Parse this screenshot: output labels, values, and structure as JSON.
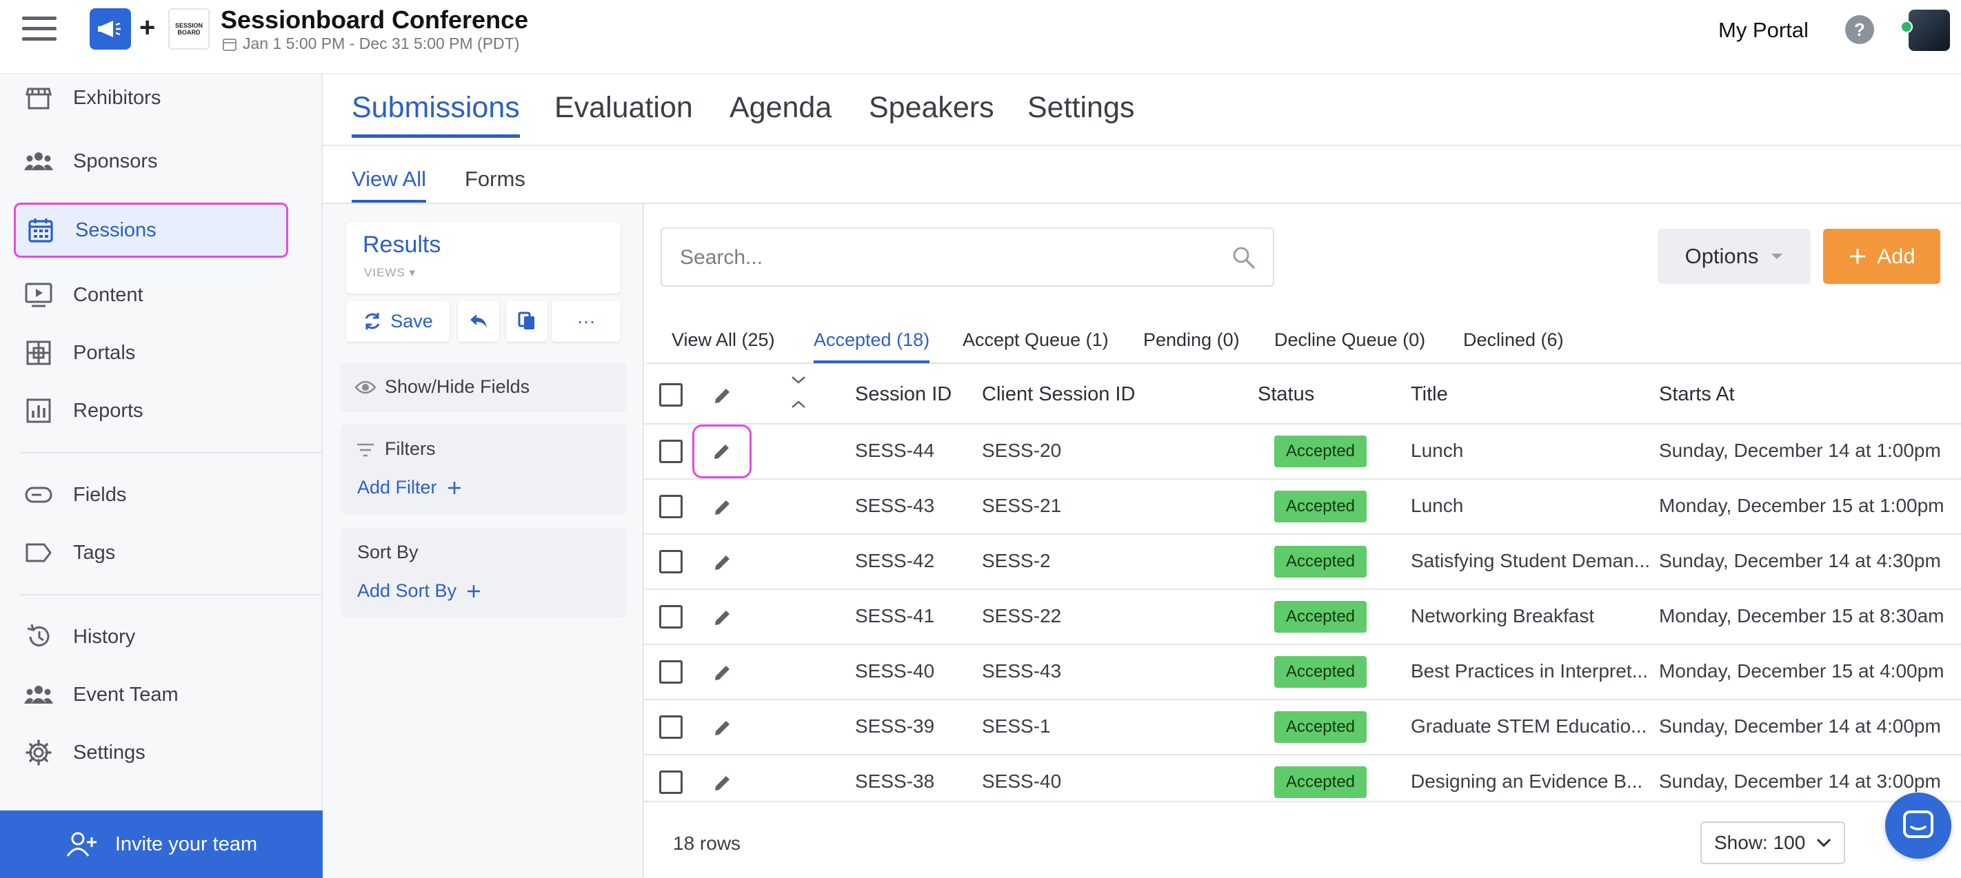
{
  "header": {
    "title": "Sessionboard Conference",
    "date_range": "Jan 1 5:00 PM - Dec 31 5:00 PM (PDT)",
    "logo_text": "SESSION BOARD",
    "my_portal": "My Portal",
    "help": "?"
  },
  "sidebar": {
    "items": [
      {
        "label": "Exhibitors",
        "icon": "store-icon"
      },
      {
        "label": "Sponsors",
        "icon": "group-icon"
      },
      {
        "label": "Sessions",
        "icon": "calendar-icon"
      },
      {
        "label": "Content",
        "icon": "video-icon"
      },
      {
        "label": "Portals",
        "icon": "portal-icon"
      },
      {
        "label": "Reports",
        "icon": "chart-icon"
      },
      {
        "label": "Fields",
        "icon": "field-icon"
      },
      {
        "label": "Tags",
        "icon": "tag-icon"
      },
      {
        "label": "History",
        "icon": "history-icon"
      },
      {
        "label": "Event Team",
        "icon": "team-icon"
      },
      {
        "label": "Settings",
        "icon": "gear-icon"
      }
    ],
    "active_item": "Sessions",
    "invite_label": "Invite your team"
  },
  "main_tabs": [
    "Submissions",
    "Evaluation",
    "Agenda",
    "Speakers",
    "Settings"
  ],
  "sub_tabs": [
    "View All",
    "Forms"
  ],
  "panel": {
    "results_title": "Results",
    "views_label": "VIEWS",
    "save_label": "Save",
    "more_label": "···",
    "show_hide_label": "Show/Hide Fields",
    "filters_label": "Filters",
    "add_filter_label": "Add Filter",
    "sort_by_label": "Sort By",
    "add_sort_label": "Add Sort By"
  },
  "toolbar": {
    "search_placeholder": "Search...",
    "options_label": "Options",
    "add_label": "Add"
  },
  "filter_tabs": [
    "View All (25)",
    "Accepted (18)",
    "Accept Queue (1)",
    "Pending (0)",
    "Decline Queue (0)",
    "Declined (6)"
  ],
  "table": {
    "columns": [
      "Session ID",
      "Client Session ID",
      "Status",
      "Title",
      "Starts At"
    ],
    "rows": [
      {
        "session_id": "SESS-44",
        "client_id": "SESS-20",
        "status": "Accepted",
        "title": "Lunch",
        "starts_at": "Sunday, December 14 at 1:00pm"
      },
      {
        "session_id": "SESS-43",
        "client_id": "SESS-21",
        "status": "Accepted",
        "title": "Lunch",
        "starts_at": "Monday, December 15 at 1:00pm"
      },
      {
        "session_id": "SESS-42",
        "client_id": "SESS-2",
        "status": "Accepted",
        "title": "Satisfying Student Deman...",
        "starts_at": "Sunday, December 14 at 4:30pm"
      },
      {
        "session_id": "SESS-41",
        "client_id": "SESS-22",
        "status": "Accepted",
        "title": "Networking Breakfast",
        "starts_at": "Monday, December 15 at 8:30am"
      },
      {
        "session_id": "SESS-40",
        "client_id": "SESS-43",
        "status": "Accepted",
        "title": "Best Practices in Interpret...",
        "starts_at": "Monday, December 15 at 4:00pm"
      },
      {
        "session_id": "SESS-39",
        "client_id": "SESS-1",
        "status": "Accepted",
        "title": "Graduate STEM Educatio...",
        "starts_at": "Sunday, December 14 at 4:00pm"
      },
      {
        "session_id": "SESS-38",
        "client_id": "SESS-40",
        "status": "Accepted",
        "title": "Designing an Evidence B...",
        "starts_at": "Sunday, December 14 at 3:00pm"
      }
    ],
    "row_count": "18 rows",
    "show_label": "Show: 100"
  },
  "colors": {
    "accent": "#2c5fc7",
    "add_button": "#f3973a",
    "accepted_badge": "#5fcb6a",
    "highlight": "#e24ce3"
  }
}
